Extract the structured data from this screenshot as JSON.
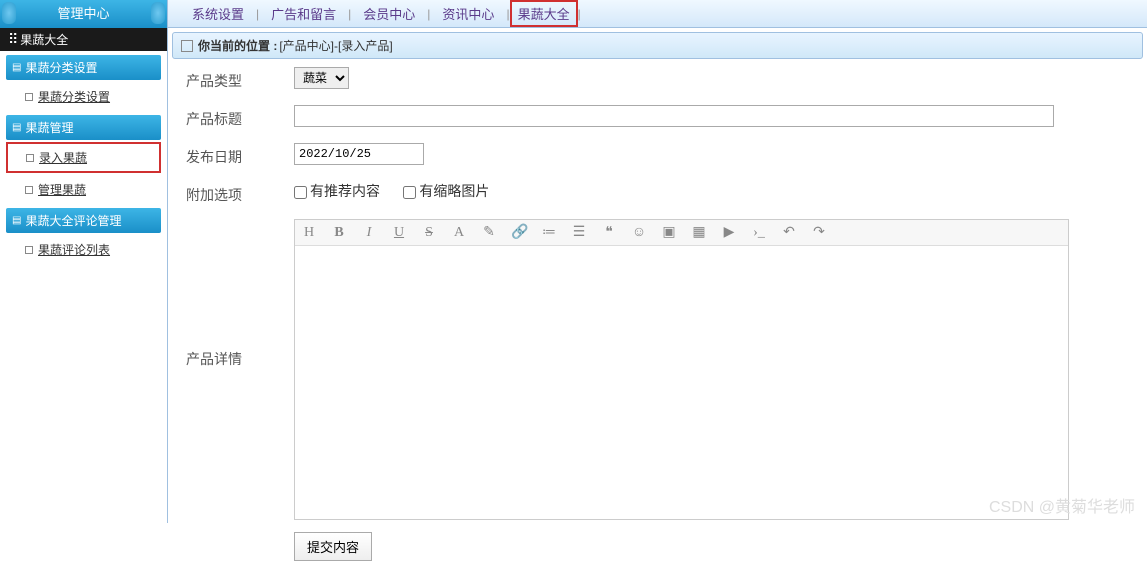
{
  "topnav": {
    "items": [
      "系统设置",
      "广告和留言",
      "会员中心",
      "资讯中心",
      "果蔬大全"
    ],
    "highlighted": 4
  },
  "sidebar": {
    "header": "管理中心",
    "root": "果蔬大全",
    "groups": [
      {
        "title": "果蔬分类设置",
        "items": [
          {
            "label": "果蔬分类设置",
            "hl": false
          }
        ]
      },
      {
        "title": "果蔬管理",
        "items": [
          {
            "label": "录入果蔬",
            "hl": true
          },
          {
            "label": "管理果蔬",
            "hl": false
          }
        ]
      },
      {
        "title": "果蔬大全评论管理",
        "items": [
          {
            "label": "果蔬评论列表",
            "hl": false
          }
        ]
      }
    ]
  },
  "breadcrumb": {
    "label": "你当前的位置 :",
    "path": "[产品中心]-[录入产品]"
  },
  "form": {
    "type_label": "产品类型",
    "type_value": "蔬菜",
    "title_label": "产品标题",
    "title_value": "",
    "date_label": "发布日期",
    "date_value": "2022/10/25",
    "extra_label": "附加选项",
    "chk1": "有推荐内容",
    "chk2": "有缩略图片",
    "detail_label": "产品详情",
    "submit": "提交内容"
  },
  "editor_toolbar": [
    "H",
    "B",
    "I",
    "U",
    "S",
    "A",
    "✎",
    "🔗",
    "≔",
    "☰",
    "❝",
    "☺",
    "▣",
    "▦",
    "▶",
    "›_",
    "↶",
    "↷"
  ],
  "watermark": "CSDN @黄菊华老师"
}
